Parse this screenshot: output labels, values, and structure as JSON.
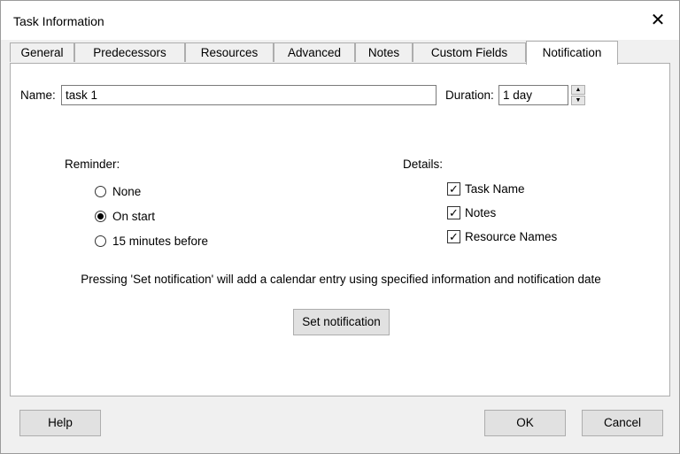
{
  "window": {
    "title": "Task Information"
  },
  "tabs": [
    {
      "label": "General"
    },
    {
      "label": "Predecessors"
    },
    {
      "label": "Resources"
    },
    {
      "label": "Advanced"
    },
    {
      "label": "Notes"
    },
    {
      "label": "Custom Fields"
    },
    {
      "label": "Notification"
    }
  ],
  "active_tab": "Notification",
  "form": {
    "name_label": "Name:",
    "name_value": "task 1",
    "duration_label": "Duration:",
    "duration_value": "1 day"
  },
  "reminder": {
    "label": "Reminder:",
    "options": [
      {
        "label": "None",
        "checked": false
      },
      {
        "label": "On start",
        "checked": true
      },
      {
        "label": "15 minutes before",
        "checked": false
      }
    ]
  },
  "details": {
    "label": "Details:",
    "options": [
      {
        "label": "Task Name",
        "checked": true
      },
      {
        "label": "Notes",
        "checked": true
      },
      {
        "label": "Resource Names",
        "checked": true
      }
    ]
  },
  "info_text": "Pressing 'Set notification' will add a calendar entry using specified information and notification date",
  "buttons": {
    "set_notification": "Set notification",
    "help": "Help",
    "ok": "OK",
    "cancel": "Cancel"
  }
}
